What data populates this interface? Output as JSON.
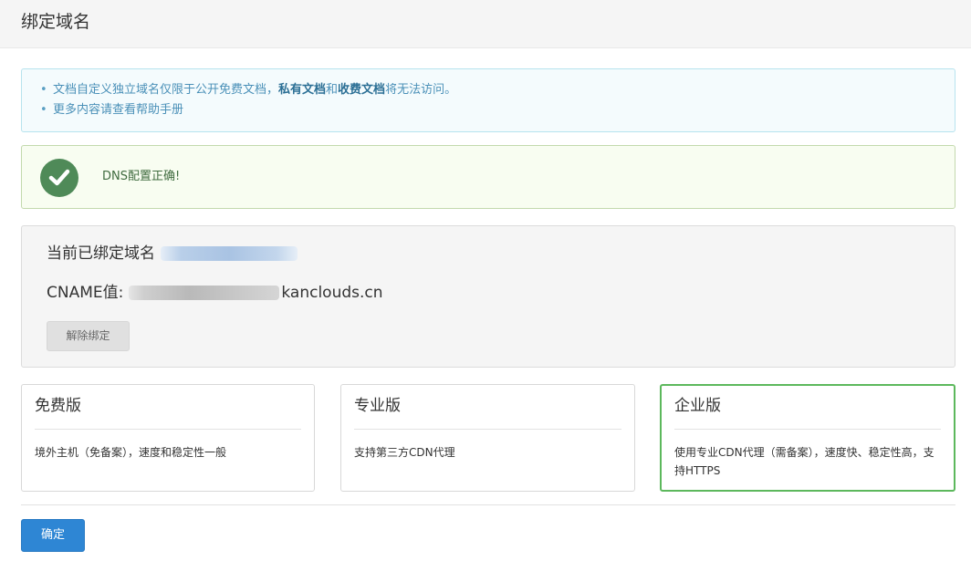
{
  "header": {
    "title": "绑定域名"
  },
  "notice": {
    "item1_prefix": "文档自定义独立域名仅限于公开免费文档，",
    "item1_bold1": "私有文档",
    "item1_mid": "和",
    "item1_bold2": "收费文档",
    "item1_suffix": "将无法访问。",
    "item2": "更多内容请查看帮助手册"
  },
  "status": {
    "text": "DNS配置正确!",
    "icon": "check-circle-icon",
    "color": "#4f8a58"
  },
  "bound": {
    "domain_label": "当前已绑定域名",
    "cname_label": "CNAME值:",
    "cname_suffix": "kanclouds.cn",
    "unbind_label": "解除绑定"
  },
  "plans": [
    {
      "title": "免费版",
      "desc": "境外主机（免备案），速度和稳定性一般",
      "selected": false
    },
    {
      "title": "专业版",
      "desc": "支持第三方CDN代理",
      "selected": false
    },
    {
      "title": "企业版",
      "desc": "使用专业CDN代理（需备案），速度快、稳定性高，支持HTTPS",
      "selected": true
    }
  ],
  "footer": {
    "confirm_label": "确定"
  },
  "colors": {
    "primary": "#2e86d4",
    "success": "#5cb85c",
    "notice_text": "#4a90b8"
  }
}
